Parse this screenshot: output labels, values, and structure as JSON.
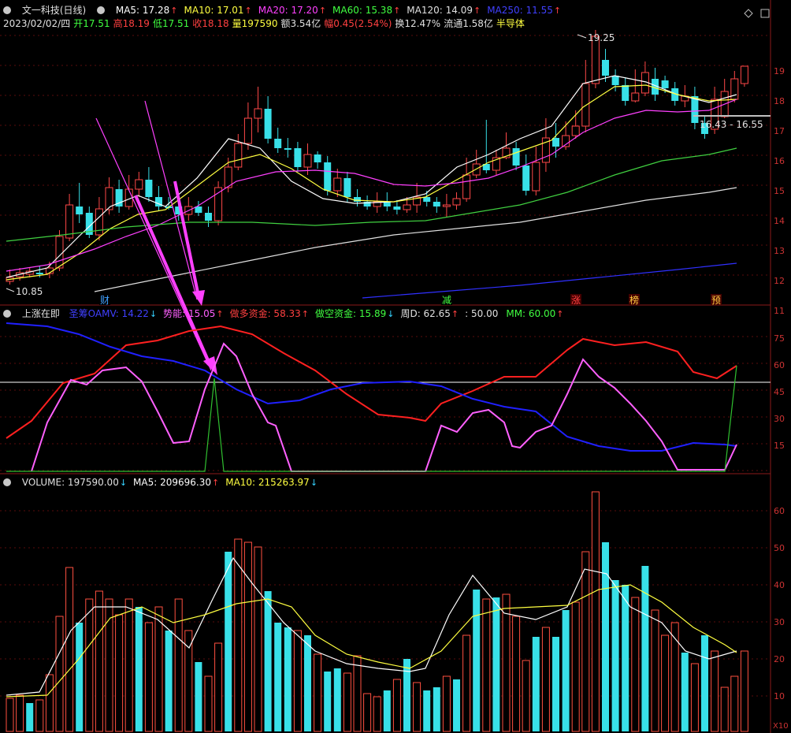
{
  "title": "文一科技(日线)",
  "ma_row": [
    {
      "label": "MA5: 17.28",
      "color": "#ffffff",
      "dir": "up"
    },
    {
      "label": "MA10: 17.01",
      "color": "#ffff40",
      "dir": "up"
    },
    {
      "label": "MA20: 17.20",
      "color": "#ff40ff",
      "dir": "up"
    },
    {
      "label": "MA60: 15.38",
      "color": "#40ff40",
      "dir": "up"
    },
    {
      "label": "MA120: 14.09",
      "color": "#e0e0e0",
      "dir": "up"
    },
    {
      "label": "MA250: 11.55",
      "color": "#4040ff",
      "dir": "up"
    }
  ],
  "info_row": [
    {
      "text": "2023/02/02/四",
      "color": "#e0e0e0"
    },
    {
      "text": "开17.51",
      "color": "#40ff40"
    },
    {
      "text": "高18.19",
      "color": "#ff4040"
    },
    {
      "text": "低17.51",
      "color": "#40ff40"
    },
    {
      "text": "收18.18",
      "color": "#ff4040"
    },
    {
      "text": "量197590",
      "color": "#ffff40"
    },
    {
      "text": "额3.54亿",
      "color": "#e0e0e0"
    },
    {
      "text": "幅0.45(2.54%)",
      "color": "#ff4040"
    },
    {
      "text": "换12.47%",
      "color": "#e0e0e0"
    },
    {
      "text": "流通1.58亿",
      "color": "#e0e0e0"
    },
    {
      "text": "半导体",
      "color": "#ffff40"
    }
  ],
  "annotations": {
    "high": "19.25",
    "low": "10.85",
    "range": "16.43 - 16.55"
  },
  "event_tags": [
    {
      "text": "财",
      "color": "#40a0ff",
      "bg": "#000"
    },
    {
      "text": "减",
      "color": "#40ff40",
      "bg": "#000"
    },
    {
      "text": "涨",
      "color": "#ff4040",
      "bg": "#400"
    },
    {
      "text": "榜",
      "color": "#ffcc40",
      "bg": "#400"
    },
    {
      "text": "预",
      "color": "#ffcc40",
      "bg": "#400"
    }
  ],
  "indicator": {
    "name": "上涨在即",
    "items": [
      {
        "label": "圣筹OAMV: 14.22",
        "color": "#4040ff",
        "dir": "dn"
      },
      {
        "label": "势能: 15.05",
        "color": "#ff60ff",
        "dir": "up"
      },
      {
        "label": "做多资金: 58.33",
        "color": "#ff4040",
        "dir": "up"
      },
      {
        "label": "做空资金: 15.89",
        "color": "#40ff40",
        "dir": "dn"
      },
      {
        "label": "周D: 62.65",
        "color": "#e0e0e0",
        "dir": "up"
      },
      {
        "label": ": 50.00",
        "color": "#e0e0e0",
        "dir": ""
      },
      {
        "label": "MM: 60.00",
        "color": "#40ff40",
        "dir": "up"
      }
    ]
  },
  "volume": {
    "items": [
      {
        "label": "VOLUME: 197590.00",
        "color": "#e0e0e0",
        "dir": "dn"
      },
      {
        "label": "MA5: 209696.30",
        "color": "#ffffff",
        "dir": "up"
      },
      {
        "label": "MA10: 215263.97",
        "color": "#ffff40",
        "dir": "dn"
      }
    ],
    "unit": "X10"
  },
  "axes": {
    "price": [
      "19",
      "18",
      "17",
      "16",
      "15",
      "14",
      "13",
      "12",
      "11"
    ],
    "indicator": [
      "75",
      "60",
      "45",
      "30",
      "15"
    ],
    "volume": [
      "60",
      "50",
      "40",
      "30",
      "20",
      "10"
    ]
  }
}
